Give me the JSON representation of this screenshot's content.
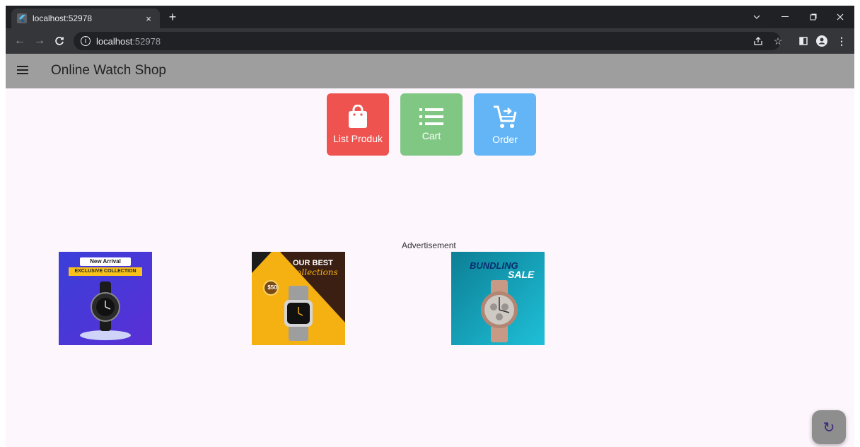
{
  "browser": {
    "tab_title": "localhost:52978",
    "new_tab_symbol": "+",
    "close_symbol": "×",
    "url_host": "localhost",
    "url_port": ":52978",
    "icons": [
      "back-icon",
      "forward-icon",
      "reload-icon",
      "info-icon",
      "share-icon",
      "star-icon",
      "side-panel-icon",
      "profile-icon",
      "more-icon"
    ]
  },
  "app": {
    "title": "Online Watch Shop",
    "appbar_color": "#9e9e9e"
  },
  "tiles": [
    {
      "label": "List Produk",
      "icon": "shopping-bag-icon",
      "color": "#ef5350"
    },
    {
      "label": "Cart",
      "icon": "list-icon",
      "color": "#81c784"
    },
    {
      "label": "Order",
      "icon": "cart-arrow-icon",
      "color": "#64b5f6"
    }
  ],
  "advertisement": {
    "label": "Advertisement",
    "banners": [
      {
        "heading": "New Arrival",
        "subheading": "EXCLUSIVE COLLECTION"
      },
      {
        "heading": "OUR BEST",
        "subheading": "Collections",
        "price": "$50"
      },
      {
        "heading": "BUNDLING",
        "subheading": "SALE"
      }
    ]
  },
  "fab": {
    "icon": "refresh-icon",
    "symbol": "↻"
  }
}
